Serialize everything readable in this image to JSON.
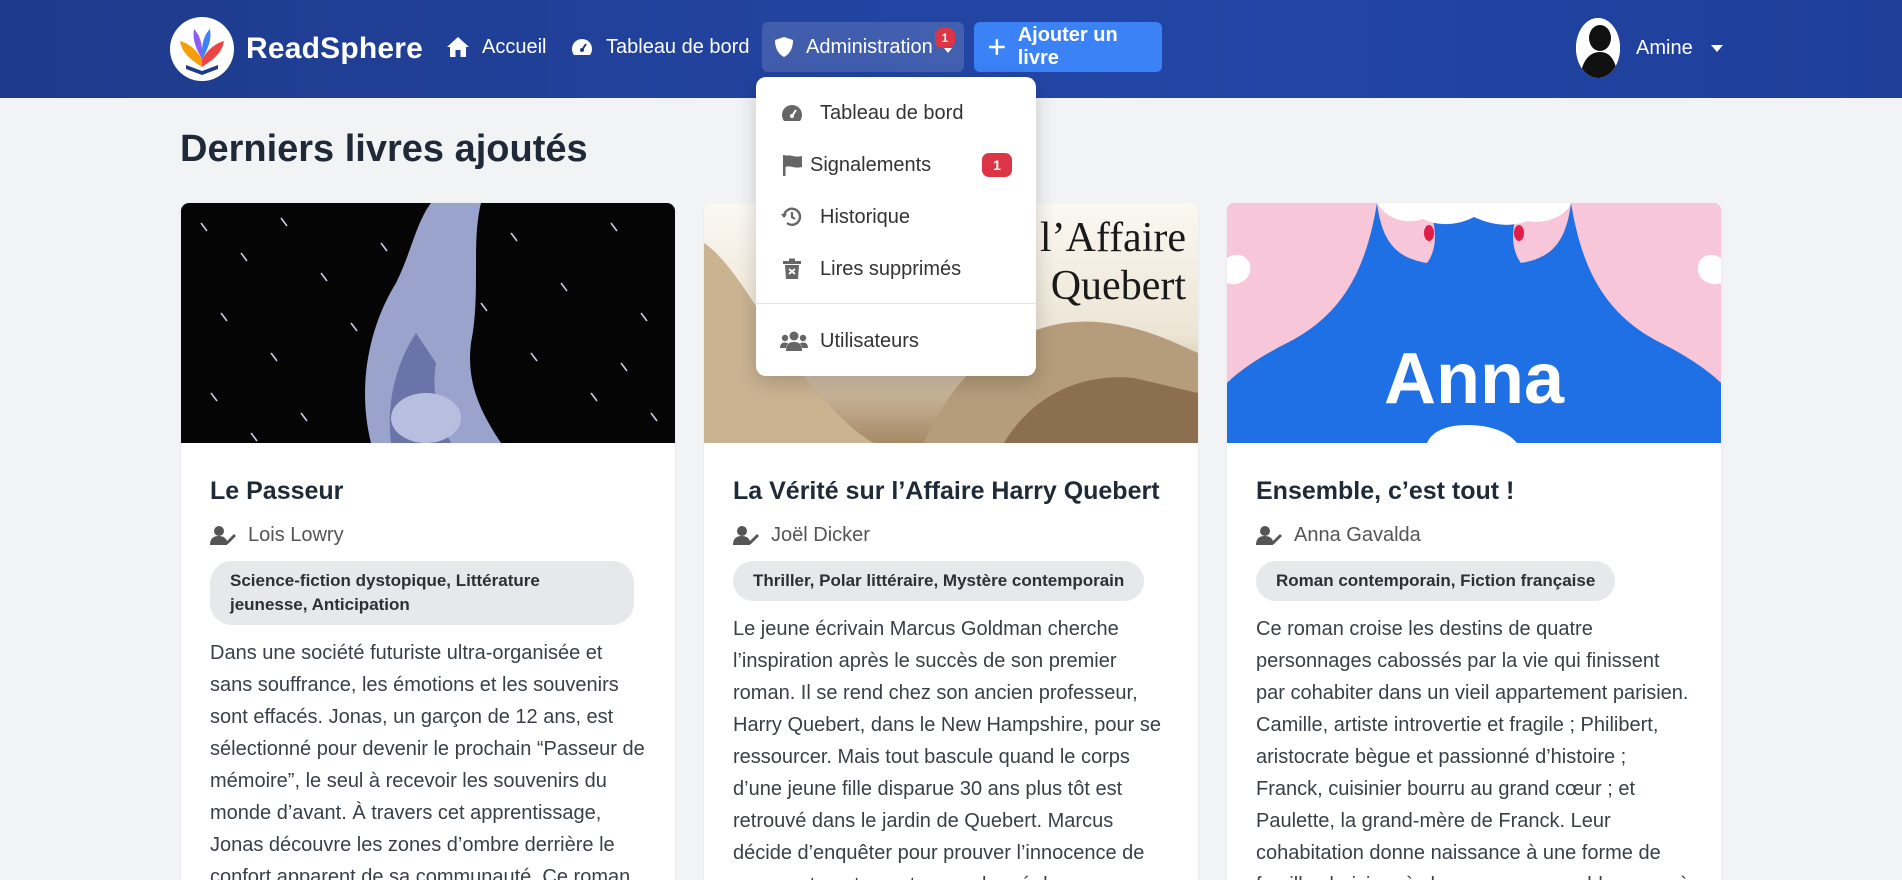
{
  "navbar": {
    "brand": "ReadSphere",
    "home_label": "Accueil",
    "dashboard_label": "Tableau de bord",
    "admin_label": "Administration",
    "admin_badge": "1",
    "add_book_label": "Ajouter un livre",
    "user_name": "Amine"
  },
  "admin_menu": {
    "items": [
      {
        "label": "Tableau de bord",
        "icon": "gauge-icon"
      },
      {
        "label": "Signalements",
        "icon": "flag-icon",
        "badge": "1"
      },
      {
        "label": "Historique",
        "icon": "history-icon"
      },
      {
        "label": "Lires supprimés",
        "icon": "trash-icon"
      },
      {
        "label": "Utilisateurs",
        "icon": "users-icon"
      }
    ]
  },
  "page": {
    "title": "Derniers livres ajoutés"
  },
  "books": [
    {
      "title": "Le Passeur",
      "author": "Lois Lowry",
      "genres": "Science-fiction dystopique, Littérature jeunesse, Anticipation",
      "description": "Dans une société futuriste ultra-organisée et sans souffrance, les émotions et les souvenirs sont effacés. Jonas, un garçon de 12 ans, est sélectionné pour devenir le prochain “Passeur de mémoire”, le seul à recevoir les souvenirs du monde d’avant. À travers cet apprentissage, Jonas découvre les zones d’ombre derrière le confort apparent de sa communauté. Ce roman"
    },
    {
      "title": "La Vérité sur l’Affaire Harry Quebert",
      "author": "Joël Dicker",
      "genres": "Thriller, Polar littéraire, Mystère contemporain",
      "cover_text_1": "l’Affaire",
      "cover_text_2": "Quebert",
      "description": "Le jeune écrivain Marcus Goldman cherche l’inspiration après le succès de son premier roman. Il se rend chez son ancien professeur, Harry Quebert, dans le New Hampshire, pour se ressourcer. Mais tout bascule quand le corps d’une jeune fille disparue 30 ans plus tôt est retrouvé dans le jardin de Quebert. Marcus décide d’enquêter pour prouver l’innocence de son mentor, et se retrouve plongé dans une"
    },
    {
      "title": "Ensemble, c’est tout !",
      "author": "Anna Gavalda",
      "genres": "Roman contemporain, Fiction française",
      "cover_text": "Anna",
      "description": "Ce roman croise les destins de quatre personnages cabossés par la vie qui finissent par cohabiter dans un vieil appartement parisien. Camille, artiste introvertie et fragile ; Philibert, aristocrate bègue et passionné d’histoire ; Franck, cuisinier bourru au grand cœur ; et Paulette, la grand-mère de Franck. Leur cohabitation donne naissance à une forme de famille choisie, où chacun panse ses blessures à"
    }
  ],
  "colors": {
    "navbar": "#1e3a8a",
    "accent": "#3b82f6",
    "badge": "#dc3545",
    "background": "#f2f3f5"
  }
}
